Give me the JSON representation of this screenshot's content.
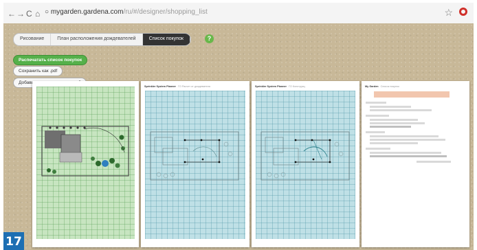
{
  "browser": {
    "url_host": "mygarden.gardena.com",
    "url_path": "/ru/#/designer/shopping_list"
  },
  "tabs": [
    {
      "label": "Рисование",
      "active": false
    },
    {
      "label": "План расположения дождевателей",
      "active": false
    },
    {
      "label": "Список покупок",
      "active": true
    }
  ],
  "help_label": "?",
  "actions": {
    "print_label": "Распечатать список покупок",
    "save_pdf_label": "Сохранить как .pdf",
    "wishlist_label": "Добавить в список пожеланий"
  },
  "pages": {
    "p2_title": "Sprinkler System Planner",
    "p2_sub": "ГО Расчет от дождевателя",
    "p3_title": "Sprinkler System Planner",
    "p3_sub": "ГО Конструкц",
    "p4_title": "My Garden",
    "p4_sub": "Список покупок"
  },
  "figure_number": "17",
  "colors": {
    "accent_green": "#55b04a",
    "badge_blue": "#1d6fb3",
    "plan_green": "#c7e5c0",
    "plan_blue": "#bfe0e6"
  }
}
